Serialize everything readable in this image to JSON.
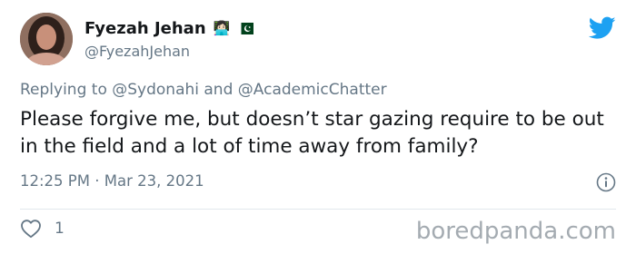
{
  "tweet": {
    "author": {
      "display_name": "Fyezah Jehan",
      "emoji": "👩🏻‍💻",
      "handle": "@FyezahJehan"
    },
    "reply_prefix": "Replying to",
    "reply_to": [
      "@Sydonahi",
      "@AcademicChatter"
    ],
    "reply_conjunction": "and",
    "text": "Please forgive me, but doesn’t star gazing require to be out in the field and a lot of time away from family?",
    "time": "12:25 PM",
    "separator": "·",
    "date": "Mar 23, 2021",
    "like_count": "1"
  },
  "watermark": "boredpanda.com",
  "colors": {
    "twitter_blue": "#1da1f2",
    "secondary_text": "#657786",
    "primary_text": "#14171a"
  },
  "icons": {
    "avatar": "profile-photo",
    "flag": "pakistan-flag-icon",
    "brand": "twitter-bird-icon",
    "info": "info-icon",
    "like": "heart-icon"
  }
}
